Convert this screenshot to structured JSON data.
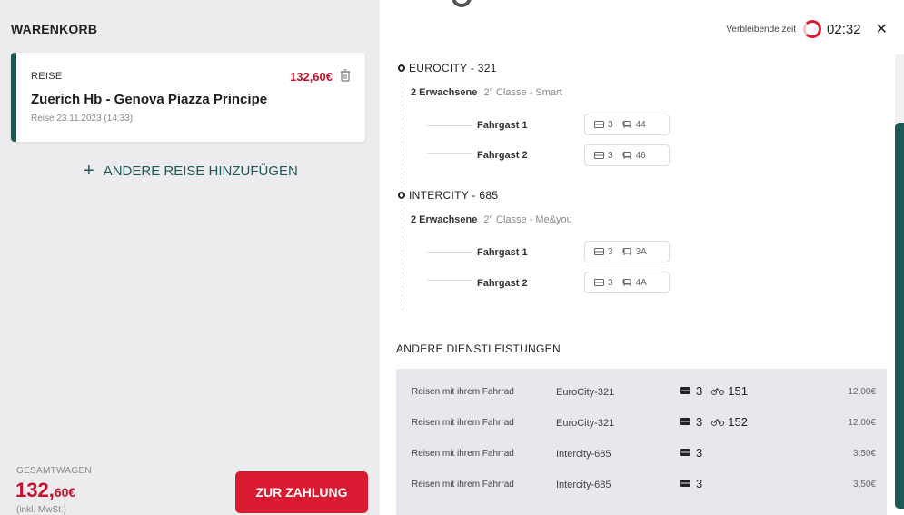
{
  "cart": {
    "title": "WARENKORB",
    "trip": {
      "type_label": "REISE",
      "price": "132,60€",
      "route": "Zuerich Hb - Genova Piazza Principe",
      "date": "Reise 23.11.2023 (14:33)"
    },
    "add_trip_label": "ANDERE REISE HINZUFÜGEN",
    "total_label": "GESAMTWAGEN",
    "total_main": "132,",
    "total_cents": "60€",
    "vat_note": "(inkl. MwSt.)",
    "pay_button_label": "ZUR ZAHLUNG"
  },
  "timer": {
    "label": "Verbleibende zeit",
    "value": "02:32"
  },
  "trains": [
    {
      "name": "EUROCITY - 321",
      "adults": "2 Erwachsene",
      "class": "2° Classe - Smart",
      "passengers": [
        {
          "label": "Fahrgast 1",
          "coach": "3",
          "seat": "44"
        },
        {
          "label": "Fahrgast 2",
          "coach": "3",
          "seat": "46"
        }
      ]
    },
    {
      "name": "INTERCITY - 685",
      "adults": "2 Erwachsene",
      "class": "2° Classe - Me&you",
      "passengers": [
        {
          "label": "Fahrgast 1",
          "coach": "3",
          "seat": "3A"
        },
        {
          "label": "Fahrgast 2",
          "coach": "3",
          "seat": "4A"
        }
      ]
    }
  ],
  "other_services": {
    "title": "ANDERE DIENSTLEISTUNGEN",
    "rows": [
      {
        "name": "Reisen mit ihrem Fahrrad",
        "train": "EuroCity-321",
        "coach": "3",
        "bike": "151",
        "price": "12,00€"
      },
      {
        "name": "Reisen mit ihrem Fahrrad",
        "train": "EuroCity-321",
        "coach": "3",
        "bike": "152",
        "price": "12,00€"
      },
      {
        "name": "Reisen mit ihrem Fahrrad",
        "train": "Intercity-685",
        "coach": "3",
        "bike": "",
        "price": "3,50€"
      },
      {
        "name": "Reisen mit ihrem Fahrrad",
        "train": "Intercity-685",
        "coach": "3",
        "bike": "",
        "price": "3,50€"
      }
    ]
  },
  "colors": {
    "accent_red": "#d91a30",
    "brand_teal": "#1d5a57",
    "panel_grey": "#ececef"
  },
  "icons": [
    "trash-icon",
    "plus-icon",
    "timer-ring-icon",
    "close-icon",
    "train-dot-icon",
    "coach-icon",
    "seat-icon",
    "bike-icon"
  ]
}
